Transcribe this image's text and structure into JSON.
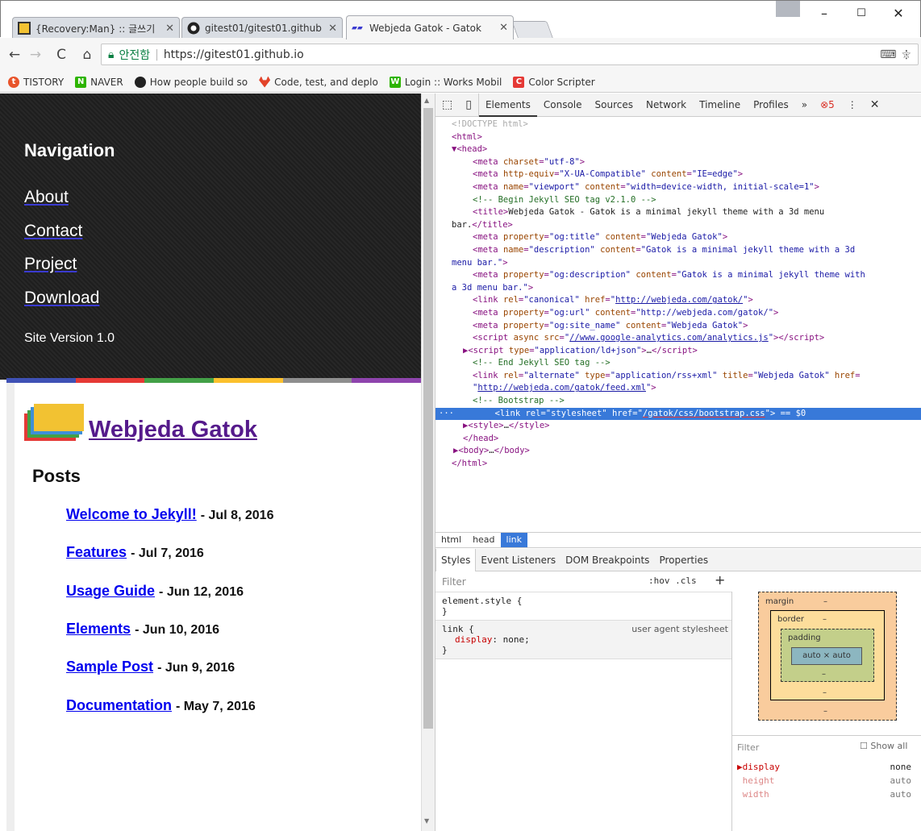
{
  "browser": {
    "tabs": [
      {
        "title": "{Recovery:Man} :: 글쓰기",
        "active": false
      },
      {
        "title": "gitest01/gitest01.github",
        "active": false
      },
      {
        "title": "Webjeda Gatok - Gatok",
        "active": true
      }
    ],
    "address": {
      "secure_label": "안전함",
      "url": "https://gitest01.github.io"
    },
    "bookmarks": [
      "TISTORY",
      "NAVER",
      "How people build so",
      "Code, test, and deplo",
      "Login :: Works Mobil",
      "Color Scripter"
    ]
  },
  "page": {
    "nav_heading": "Navigation",
    "nav_links": [
      "About",
      "Contact",
      "Project",
      "Download"
    ],
    "site_version": "Site Version 1.0",
    "site_title": "Webjeda Gatok",
    "posts_heading": "Posts",
    "posts": [
      {
        "title": "Welcome to Jekyll!",
        "date": "- Jul 8, 2016"
      },
      {
        "title": "Features",
        "date": "- Jul 7, 2016"
      },
      {
        "title": "Usage Guide",
        "date": "- Jun 12, 2016"
      },
      {
        "title": "Elements",
        "date": "- Jun 10, 2016"
      },
      {
        "title": "Sample Post",
        "date": "- Jun 9, 2016"
      },
      {
        "title": "Documentation",
        "date": "- May 7, 2016"
      }
    ],
    "colorbar": [
      "#3f51b5",
      "#e53935",
      "#43a047",
      "#fbc02d",
      "#8e8e8e",
      "#8e44ad"
    ]
  },
  "devtools": {
    "tabs": [
      "Elements",
      "Console",
      "Sources",
      "Network",
      "Timeline",
      "Profiles",
      "»"
    ],
    "error_count": "5",
    "breadcrumbs": [
      "html",
      "head",
      "link"
    ],
    "subtabs": [
      "Styles",
      "Event Listeners",
      "DOM Breakpoints",
      "Properties"
    ],
    "filter_placeholder": "Filter",
    "hov_cls": ":hov  .cls",
    "element_style": "element.style {",
    "close_brace": "}",
    "ua_rule_selector": "link {",
    "ua_rule_source": "user agent stylesheet",
    "ua_rule_prop": "display",
    "ua_rule_val": "none;",
    "box": {
      "margin": "margin",
      "border": "border",
      "padding": "padding",
      "dash": "–",
      "content": "auto × auto"
    },
    "computed_filter": "Filter",
    "show_all": "Show all",
    "computed": [
      {
        "prop": "display",
        "val": "none"
      },
      {
        "prop": "height",
        "val": "auto"
      },
      {
        "prop": "width",
        "val": "auto"
      }
    ],
    "selected_marker": "== $0"
  }
}
